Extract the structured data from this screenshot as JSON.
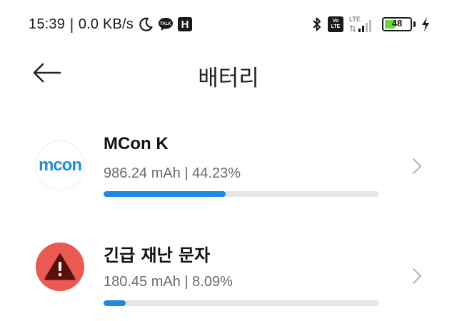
{
  "status_bar": {
    "time": "15:39",
    "separator": "|",
    "net_speed": "0.0 KB/s",
    "talk_badge": "TALK",
    "h_badge": "H",
    "volte_line1": "Vo",
    "volte_line2": "LTE",
    "network": "LTE",
    "battery_percent": "48",
    "battery_level": 0.48,
    "icons": [
      "moon-icon",
      "talk-icon",
      "h-icon",
      "bluetooth-icon",
      "volte-icon",
      "signal-icon",
      "battery-icon",
      "charging-icon"
    ]
  },
  "header": {
    "title": "배터리",
    "back_icon": "back-arrow-icon"
  },
  "apps": [
    {
      "name": "MCon K",
      "logo_text": "mcon",
      "usage": "986.24 mAh | 44.23%",
      "fraction": 0.4423
    },
    {
      "name": "긴급 재난 문자",
      "usage": "180.45 mAh | 8.09%",
      "fraction": 0.0809
    }
  ],
  "colors": {
    "accent": "#1e88e5",
    "track": "#e6e6e6",
    "alert_red": "#ea5a52",
    "mcon_blue": "#1d8fd6",
    "battery_green": "#6fd63a"
  }
}
